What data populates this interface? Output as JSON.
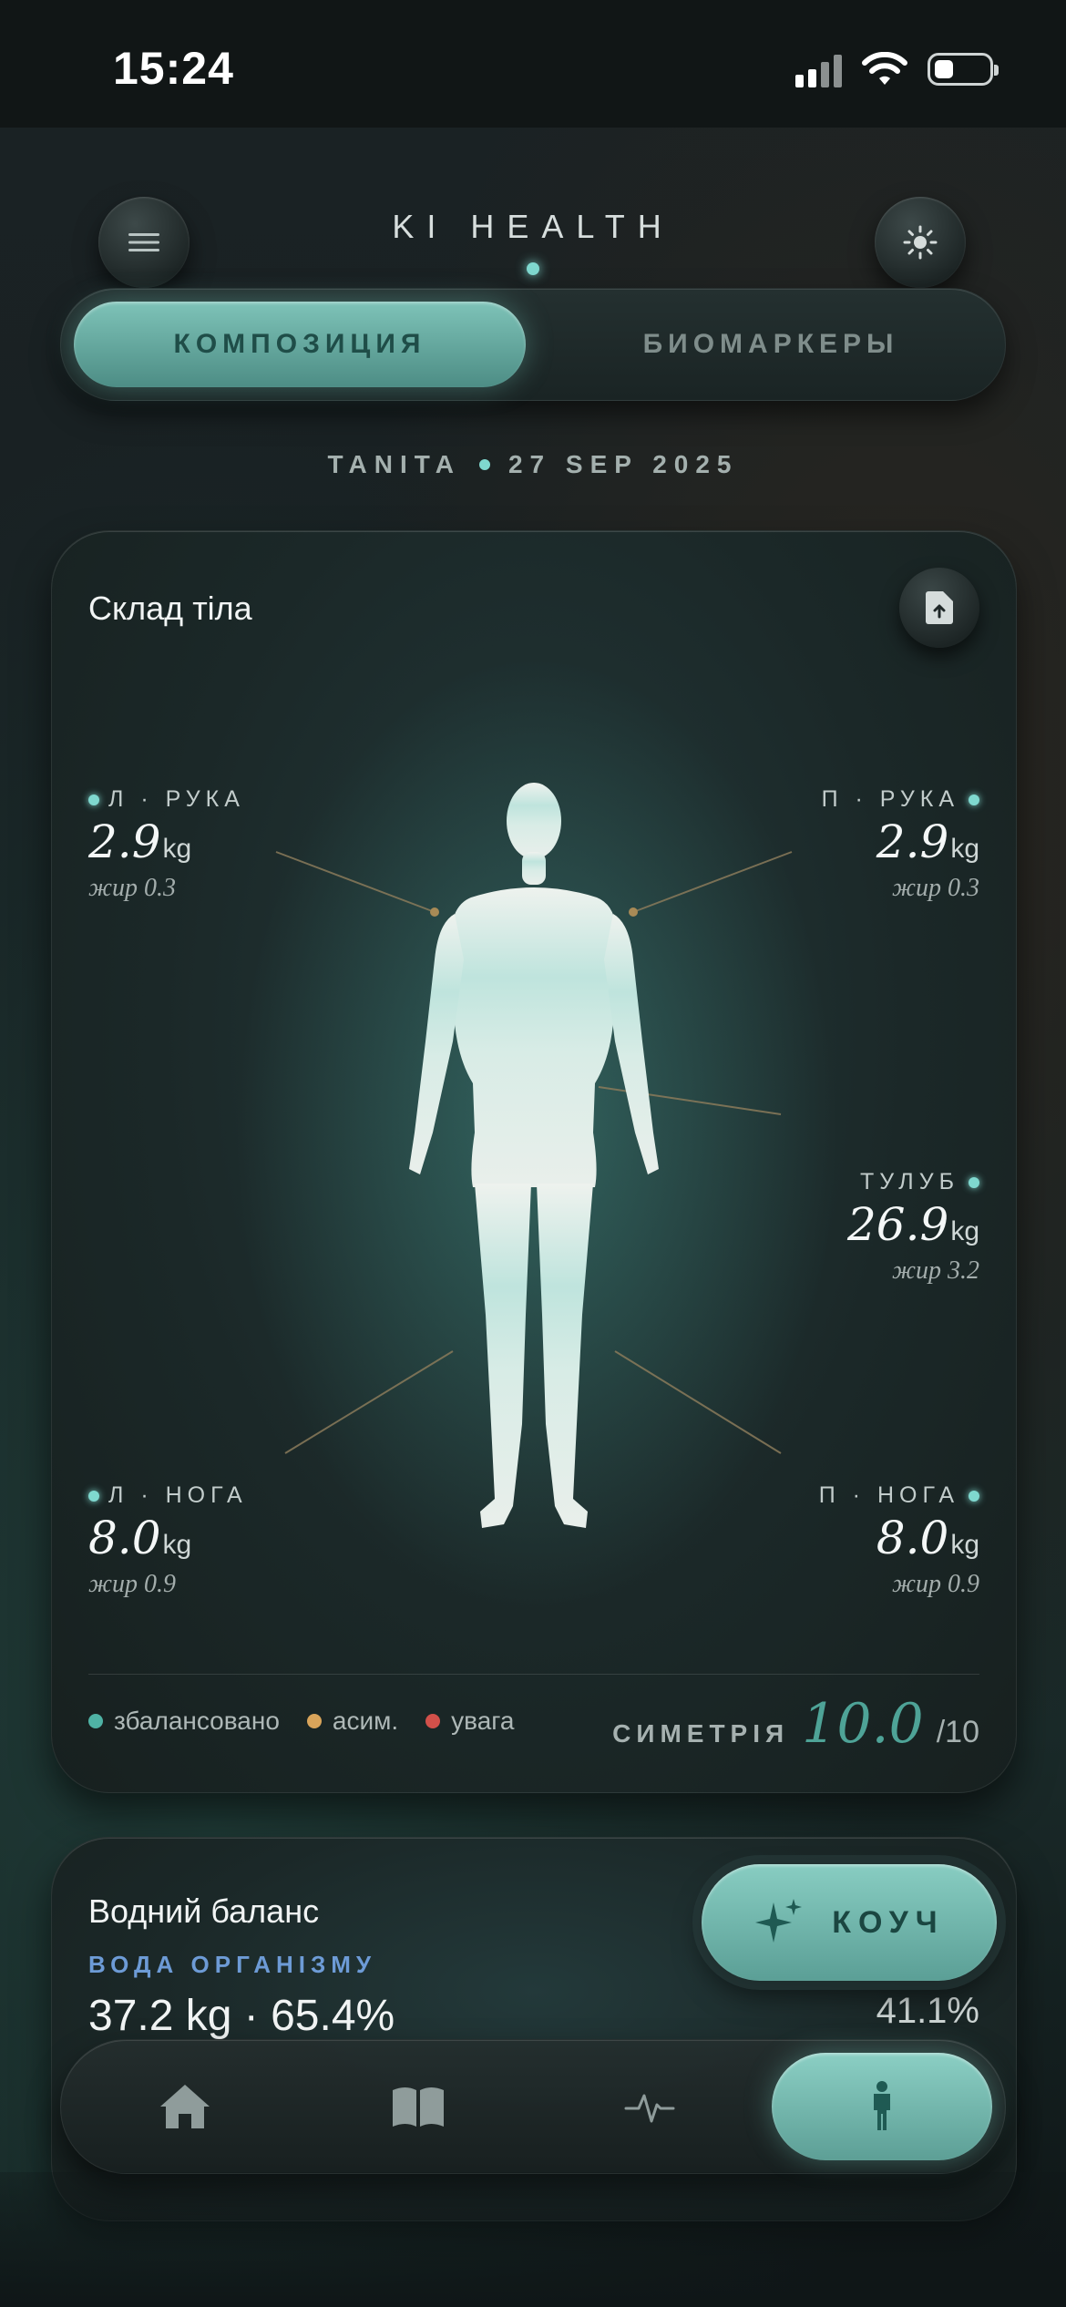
{
  "status_bar": {
    "time": "15:24"
  },
  "header": {
    "app_title": "KI HEALTH"
  },
  "segmented": {
    "tab_composition": "КОМПОЗИЦИЯ",
    "tab_biomarkers": "БИОМАРКЕРЫ",
    "active": "КОМПОЗИЦИЯ"
  },
  "meta": {
    "device": "TANITA",
    "date": "27 SEP 2025"
  },
  "body_card": {
    "title": "Склад тіла",
    "segments": {
      "left_arm": {
        "label": "Л · РУКА",
        "value": "2.9",
        "unit": "kg",
        "fat": "жир 0.3"
      },
      "right_arm": {
        "label": "П · РУКА",
        "value": "2.9",
        "unit": "kg",
        "fat": "жир 0.3"
      },
      "trunk": {
        "label": "ТУЛУБ",
        "value": "26.9",
        "unit": "kg",
        "fat": "жир 3.2"
      },
      "left_leg": {
        "label": "Л · НОГА",
        "value": "8.0",
        "unit": "kg",
        "fat": "жир 0.9"
      },
      "right_leg": {
        "label": "П · НОГА",
        "value": "8.0",
        "unit": "kg",
        "fat": "жир 0.9"
      }
    },
    "legend": [
      {
        "label": "збалансовано",
        "color": "#4fb3a5"
      },
      {
        "label": "асим.",
        "color": "#d9a45a"
      },
      {
        "label": "увага",
        "color": "#d2504a"
      }
    ],
    "symmetry": {
      "label": "СИМЕТРІЯ",
      "value": "10.0",
      "denominator": "/10"
    }
  },
  "water_card": {
    "title": "Водний баланс",
    "label": "ВОДА ОРГАНІЗМУ",
    "value": "37.2 kg · 65.4%",
    "right_value": "41.1%"
  },
  "coach_button": {
    "label": "КОУЧ"
  },
  "tab_bar": {
    "items": [
      {
        "icon": "home-icon"
      },
      {
        "icon": "book-icon"
      },
      {
        "icon": "pulse-icon"
      },
      {
        "icon": "person-icon",
        "active": true
      }
    ]
  },
  "colors": {
    "accent": "#7fd8cf",
    "accent_dark": "#4ea397"
  }
}
